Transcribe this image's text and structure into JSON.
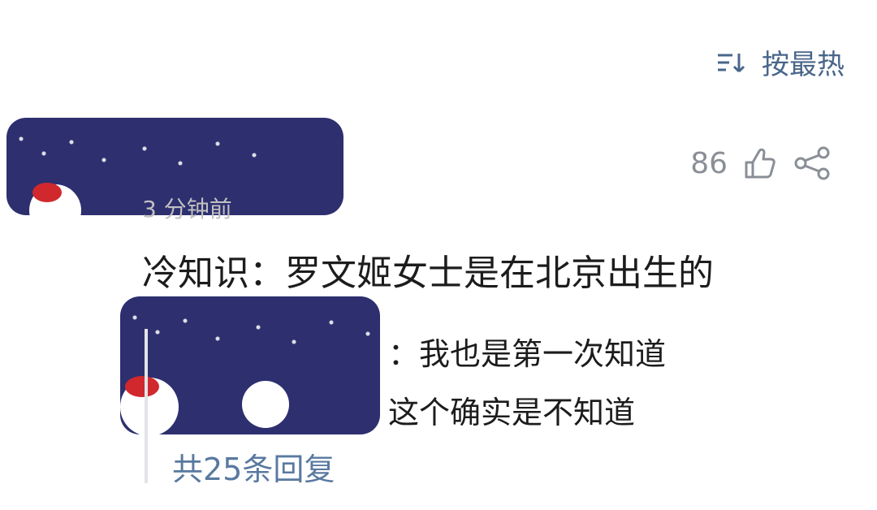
{
  "toolbar": {
    "sort_label": "按最热"
  },
  "comment": {
    "time": "3 分钟前",
    "text": "冷知识：罗文姬女士是在北京出生的",
    "likes": "86"
  },
  "replies": {
    "items": [
      {
        "text": "：我也是第一次知道"
      },
      {
        "text": "这个确实是不知道"
      }
    ],
    "count_label": "共25条回复"
  },
  "icons": {
    "sort": "sort-icon",
    "like": "thumbs-up-icon",
    "share": "share-icon"
  },
  "colors": {
    "accent": "#49668a",
    "link": "#5979a0",
    "muted": "#8a8f96"
  }
}
